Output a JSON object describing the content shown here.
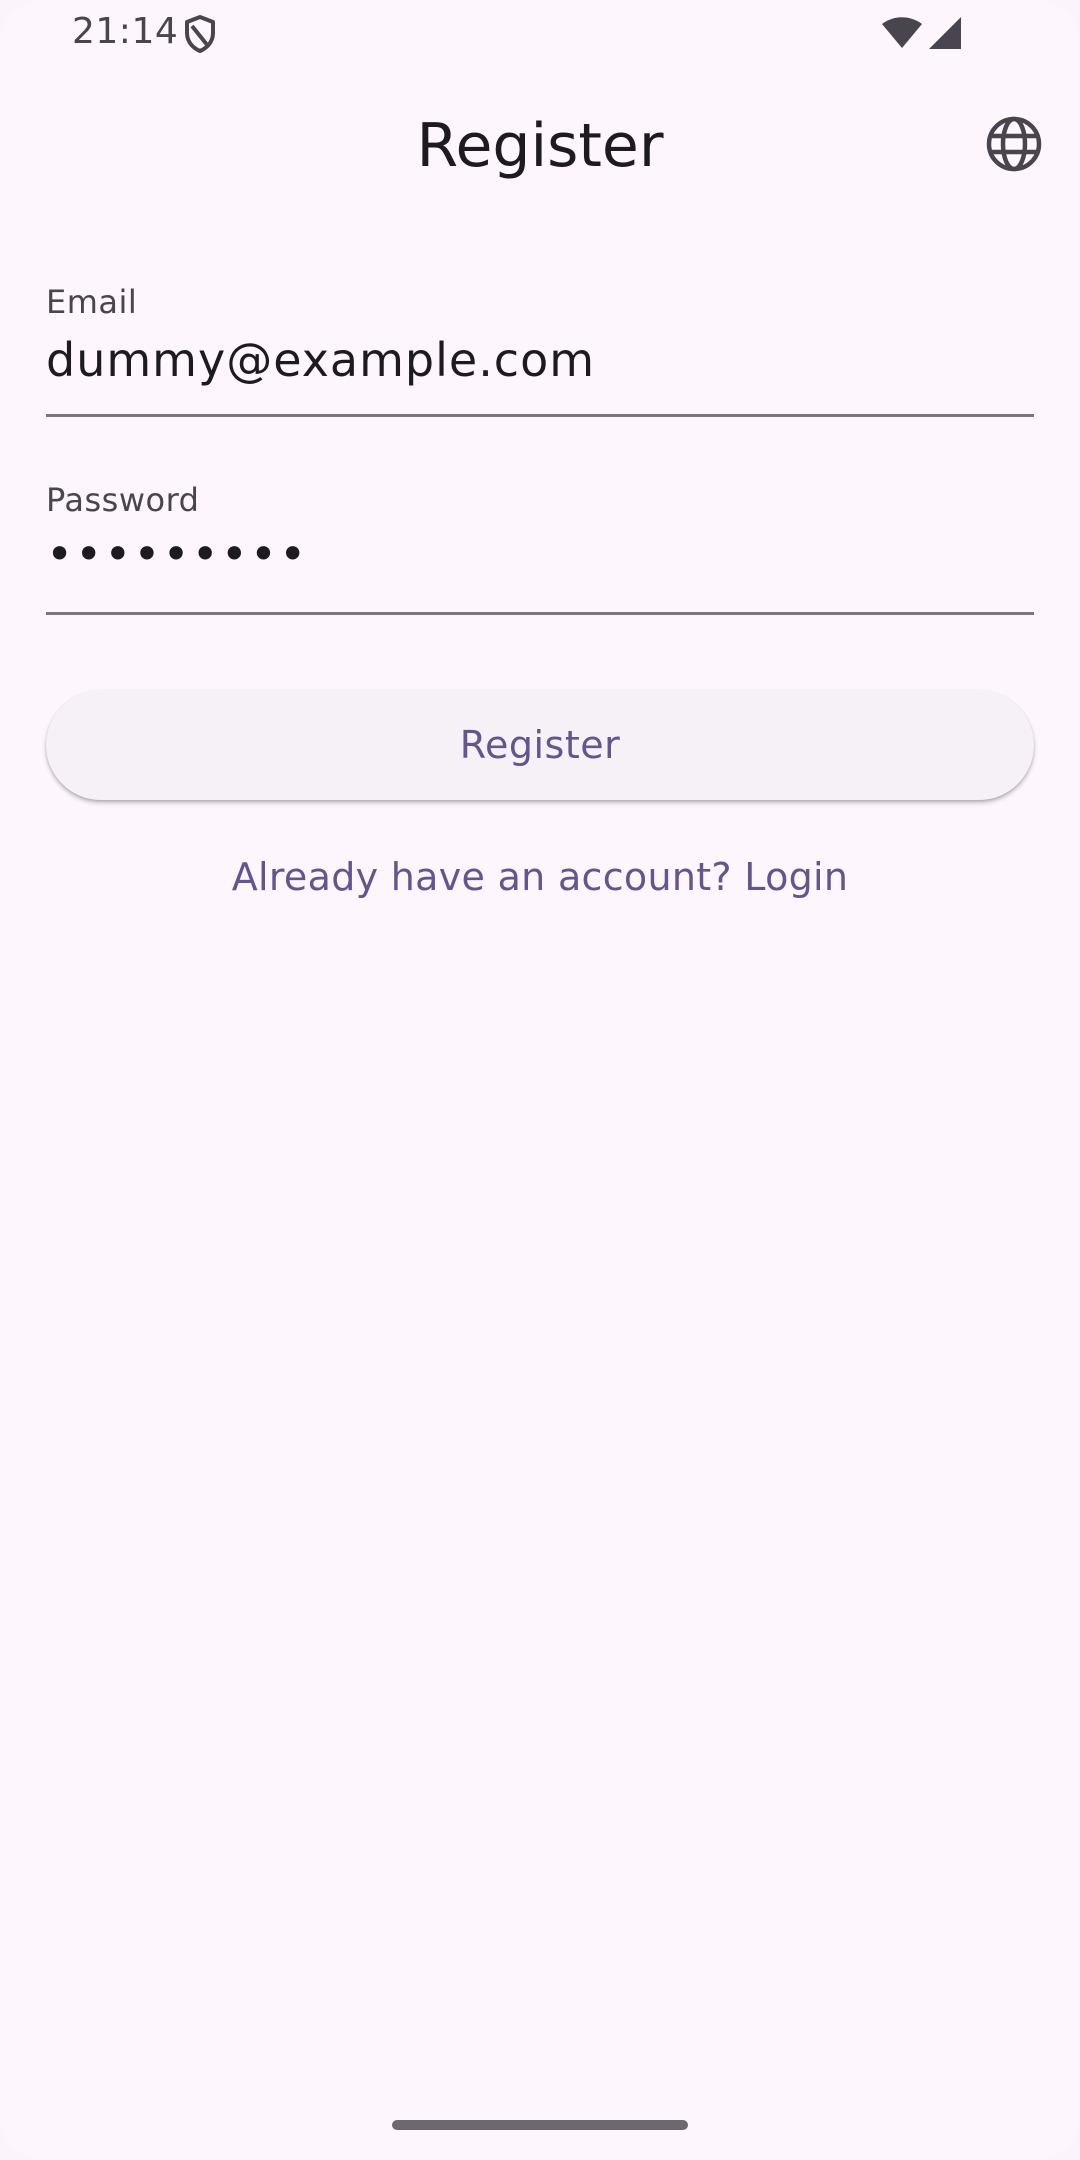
{
  "status_bar": {
    "time": "21:14",
    "shield_icon": "shield-icon",
    "wifi_icon": "wifi-icon",
    "signal_icon": "cell-signal-icon"
  },
  "app_bar": {
    "title": "Register",
    "language_icon": "globe-icon"
  },
  "form": {
    "email": {
      "label": "Email",
      "value": "dummy@example.com"
    },
    "password": {
      "label": "Password",
      "value": "•••••••••"
    },
    "register_label": "Register",
    "login_link": "Already have an account? Login"
  },
  "colors": {
    "background": "#fdf6fc",
    "primary": "#65558f",
    "on_surface": "#1d1b20",
    "on_surface_variant": "#49454f",
    "outline": "#79747e"
  }
}
